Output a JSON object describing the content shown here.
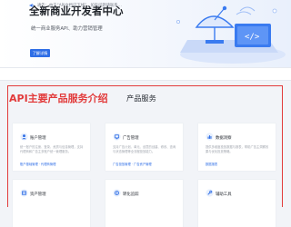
{
  "hero": {
    "title": "全新商业开发者中心",
    "subtitle": "统一商业服务API、助力营销管理",
    "button_label": "了解详情"
  },
  "notice": {
    "text": "通告：由于“API文档已下线”，如有问题请联系…"
  },
  "section": {
    "title": "API主要产品服务介绍",
    "title_alt": "产品服务"
  },
  "cards": [
    {
      "title": "账户管理",
      "desc": "统一账户的注册、登录、资质与信息管理，支持代理商和广告主多账户统一管理服务。",
      "links": "账户基础管理  ·  代理商管理"
    },
    {
      "title": "广告管理",
      "desc": "支持广告计划、单元、创意的创建、修改、查询与状态管理等全流程投放能力。",
      "links": "广告投放管理  ·  广告资产管理"
    },
    {
      "title": "数据洞察",
      "desc": "提供多维度投放数据与报表，帮助广告主洞察效果与优化投放策略。",
      "links": "数据报表"
    },
    {
      "title": "资产管理",
      "desc": "",
      "links": ""
    },
    {
      "title": "转化追踪",
      "desc": "",
      "links": ""
    },
    {
      "title": "辅助工具",
      "desc": "",
      "links": ""
    }
  ],
  "icons": {
    "hero": "satellite-dish-illustration",
    "notice": "speaker-icon",
    "account": "account-icon",
    "ads": "ads-icon",
    "data": "data-icon",
    "assets": "assets-icon",
    "conversion": "conversion-icon",
    "tools": "tools-icon"
  },
  "colors": {
    "accent": "#2f6ee6",
    "highlight": "#e23b3b",
    "page_bg": "#f2f4f8"
  }
}
